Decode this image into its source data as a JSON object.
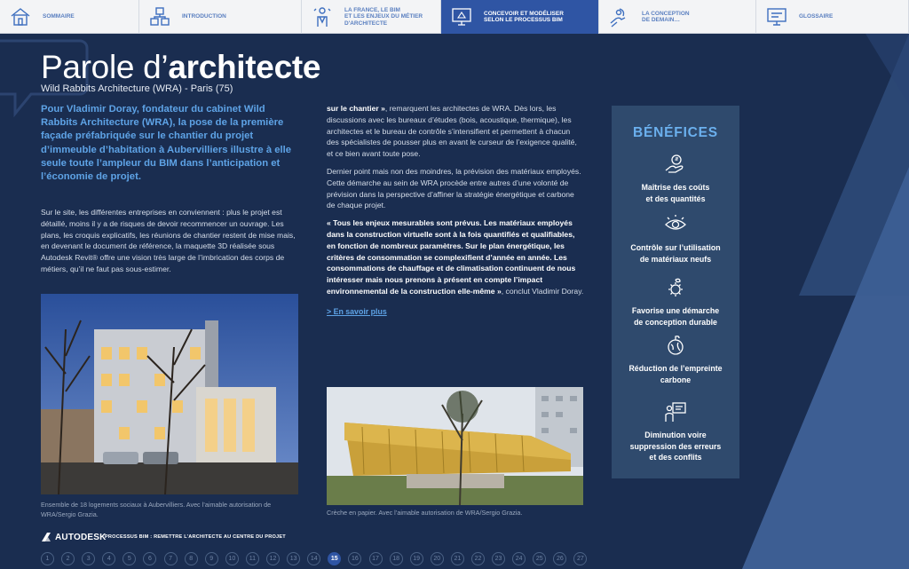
{
  "nav": [
    {
      "label": "SOMMAIRE",
      "icon": "house-icon",
      "width": 157,
      "active": false
    },
    {
      "label": "INTRODUCTION",
      "icon": "cubes-icon",
      "width": 183,
      "active": false
    },
    {
      "label": "LA FRANCE, LE BIM\nET LES ENJEUX DU MÉTIER\nD'ARCHITECTE",
      "icon": "person-icon",
      "width": 157,
      "active": false
    },
    {
      "label": "CONCEVOIR ET MODÉLISER\nSELON LE PROCESSUS BIM",
      "icon": "model-screen-icon",
      "width": 178,
      "active": true
    },
    {
      "label": "LA CONCEPTION\nDE DEMAIN…",
      "icon": "hands-icon",
      "width": 177,
      "active": false
    },
    {
      "label": "GLOSSAIRE",
      "icon": "glossary-screen-icon",
      "width": 172,
      "active": false
    }
  ],
  "page": {
    "title_light": "Parole d’",
    "title_bold": "architecte",
    "subtitle": "Wild Rabbits Architecture (WRA) - Paris (75)",
    "lead": "Pour Vladimir Doray, fondateur du cabinet Wild Rabbits Architecture (WRA), la pose de la première façade préfabriquée sur le chantier du projet d’immeuble d’habitation à Aubervilliers illustre à elle seule toute l’ampleur du BIM dans l’anticipation et l’économie de projet.",
    "col1_text": "Sur le site, les différentes entreprises en conviennent : plus le projet est détaillé, moins il y a de risques de devoir recommencer un ouvrage. Les plans, les croquis explicatifs, les réunions de chantier restent de mise mais, en devenant le document de référence, la maquette 3D réalisée sous Autodesk Revit® offre une vision très large de l’imbrication des corps de métiers, qu’il ne faut pas sous-estimer.",
    "col2_p1_bold": "sur le chantier »",
    "col2_p1_rest": ", remarquent les architectes de WRA. Dès lors, les discussions avec les bureaux d’études (bois, acoustique, thermique), les architectes et le bureau de contrôle s’intensifient et permettent à chacun des spécialistes de pousser plus en avant le curseur de l’exigence qualité, et ce bien avant toute pose.",
    "col2_p2": "Dernier point mais non des moindres, la prévision des matériaux employés. Cette démarche au sein de WRA procède entre autres d’une volonté de prévision dans la perspective d’affiner la stratégie énergétique et carbone de chaque projet.",
    "col2_p3_bold": "« Tous les enjeux mesurables sont prévus. Les matériaux employés dans la construction virtuelle sont à la fois quantifiés et qualifiables, en fonction de nombreux paramètres. Sur le plan énergétique, les critères de consommation se complexifient d’année en année. Les consommations de chauffage et de climatisation continuent de nous intéresser mais nous prenons à présent en compte l’impact environnemental de la construction elle-même »",
    "col2_p3_rest": ", conclut Vladimir Doray.",
    "more_link": "> En savoir plus",
    "caption1": "Ensemble de 18 logements sociaux à Aubervilliers. Avec l’aimable autorisation de WRA/Sergio Grazia.",
    "caption2": "Crèche en papier. Avec l’aimable autorisation de WRA/Sergio Grazia."
  },
  "benefits": {
    "title": "BÉNÉFICES",
    "items": [
      {
        "icon": "money-hand-icon",
        "label": "Maîtrise des coûts\net des quantités"
      },
      {
        "icon": "eye-icon",
        "label": "Contrôle sur l’utilisation\nde matériaux neufs"
      },
      {
        "icon": "gear-leaf-icon",
        "label": "Favorise une démarche\nde conception durable"
      },
      {
        "icon": "globe-leaf-icon",
        "label": "Réduction de l’empreinte\ncarbone"
      },
      {
        "icon": "person-board-icon",
        "label": "Diminution voire\nsuppression des erreurs\net des conflits"
      }
    ]
  },
  "footer": {
    "brand": "AUTODESK",
    "title": "PROCESSUS BIM : REMETTRE L’ARCHITECTE AU CENTRE DU PROJET",
    "pages": [
      "1",
      "2",
      "3",
      "4",
      "5",
      "6",
      "7",
      "8",
      "9",
      "10",
      "11",
      "12",
      "13",
      "14",
      "15",
      "16",
      "17",
      "18",
      "19",
      "20",
      "21",
      "22",
      "23",
      "24",
      "25",
      "26",
      "27"
    ],
    "current_page": "15"
  },
  "colors": {
    "background": "#1a2d50",
    "accent": "#2f55a4",
    "lead_text": "#5ea3e6",
    "benefit_panel": "#2f4a6d"
  }
}
